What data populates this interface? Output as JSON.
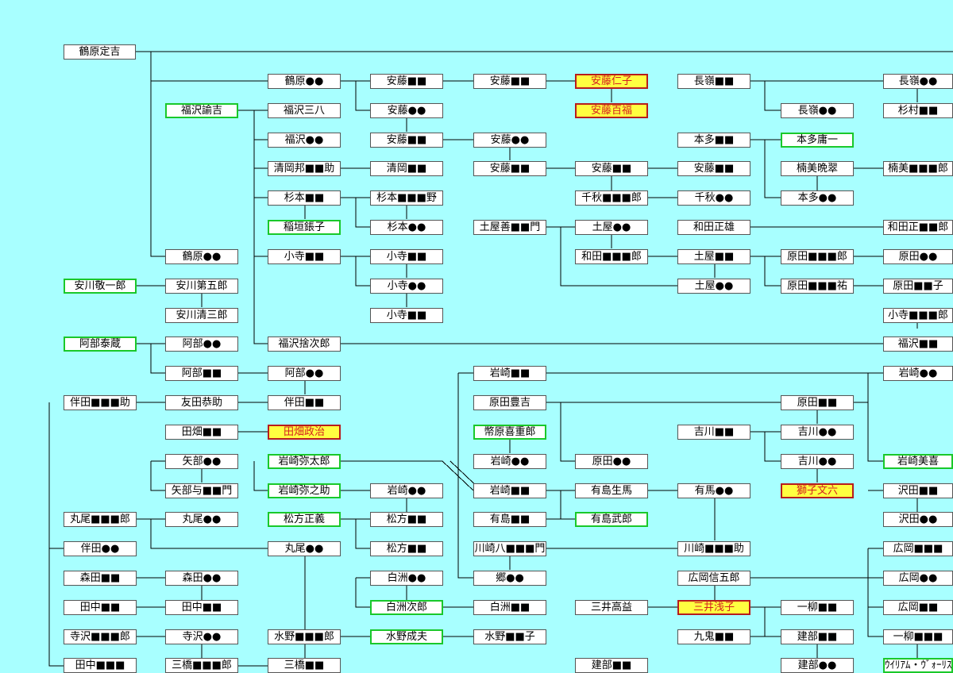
{
  "colors": {
    "background": "#a8ffff",
    "line": "#000000",
    "green_border": "#19c82a",
    "red_border": "#b71c1c",
    "highlight_fill": "#ffff40",
    "highlight_text": "#d42020"
  },
  "nodes": [
    {
      "text": "鶴原定吉",
      "style": "plain"
    },
    {
      "text": "鶴原●●",
      "style": "plain"
    },
    {
      "text": "福沢諭吉",
      "style": "green"
    },
    {
      "text": "福沢三八",
      "style": "plain"
    },
    {
      "text": "福沢●●",
      "style": "plain"
    },
    {
      "text": "清岡邦■■助",
      "style": "plain"
    },
    {
      "text": "杉本■■",
      "style": "plain"
    },
    {
      "text": "稲垣鋹子",
      "style": "green"
    },
    {
      "text": "小寺■■",
      "style": "plain"
    },
    {
      "text": "鶴原●●",
      "style": "plain"
    },
    {
      "text": "安川敬一郎",
      "style": "green"
    },
    {
      "text": "安川第五郎",
      "style": "plain"
    },
    {
      "text": "安川清三郎",
      "style": "plain"
    },
    {
      "text": "阿部泰蔵",
      "style": "green"
    },
    {
      "text": "阿部●●",
      "style": "plain"
    },
    {
      "text": "福沢捨次郎",
      "style": "plain"
    },
    {
      "text": "阿部■■",
      "style": "plain"
    },
    {
      "text": "阿部●●",
      "style": "plain"
    },
    {
      "text": "伴田■■■助",
      "style": "plain"
    },
    {
      "text": "友田恭助",
      "style": "plain"
    },
    {
      "text": "伴田■■",
      "style": "plain"
    },
    {
      "text": "田畑■■",
      "style": "plain"
    },
    {
      "text": "田畑政治",
      "style": "red"
    },
    {
      "text": "矢部●●",
      "style": "plain"
    },
    {
      "text": "岩崎弥太郎",
      "style": "green"
    },
    {
      "text": "矢部与■■門",
      "style": "plain"
    },
    {
      "text": "岩崎弥之助",
      "style": "green"
    },
    {
      "text": "丸尾■■■郎",
      "style": "plain"
    },
    {
      "text": "丸尾●●",
      "style": "plain"
    },
    {
      "text": "松方正義",
      "style": "green"
    },
    {
      "text": "伴田●●",
      "style": "plain"
    },
    {
      "text": "丸尾●●",
      "style": "plain"
    },
    {
      "text": "森田■■",
      "style": "plain"
    },
    {
      "text": "森田●●",
      "style": "plain"
    },
    {
      "text": "田中■■",
      "style": "plain"
    },
    {
      "text": "田中■■",
      "style": "plain"
    },
    {
      "text": "寺沢■■■郎",
      "style": "plain"
    },
    {
      "text": "寺沢●●",
      "style": "plain"
    },
    {
      "text": "水野■■■郎",
      "style": "plain"
    },
    {
      "text": "田中■■■",
      "style": "plain"
    },
    {
      "text": "三橋■■■郎",
      "style": "plain"
    },
    {
      "text": "三橋■■",
      "style": "plain"
    },
    {
      "text": "安藤■■",
      "style": "plain"
    },
    {
      "text": "安藤●●",
      "style": "plain"
    },
    {
      "text": "安藤■■",
      "style": "plain"
    },
    {
      "text": "清岡■■",
      "style": "plain"
    },
    {
      "text": "杉本■■■野",
      "style": "plain"
    },
    {
      "text": "杉本●●",
      "style": "plain"
    },
    {
      "text": "小寺■■",
      "style": "plain"
    },
    {
      "text": "小寺●●",
      "style": "plain"
    },
    {
      "text": "小寺■■",
      "style": "plain"
    },
    {
      "text": "岩崎●●",
      "style": "plain"
    },
    {
      "text": "松方■■",
      "style": "plain"
    },
    {
      "text": "松方■■",
      "style": "plain"
    },
    {
      "text": "白洲●●",
      "style": "plain"
    },
    {
      "text": "白洲次郎",
      "style": "green"
    },
    {
      "text": "水野成夫",
      "style": "green"
    },
    {
      "text": "安藤■■",
      "style": "plain"
    },
    {
      "text": "安藤●●",
      "style": "plain"
    },
    {
      "text": "安藤■■",
      "style": "plain"
    },
    {
      "text": "土屋善■■門",
      "style": "plain"
    },
    {
      "text": "岩崎■■",
      "style": "plain"
    },
    {
      "text": "原田豊吉",
      "style": "plain"
    },
    {
      "text": "幣原喜重郎",
      "style": "green"
    },
    {
      "text": "岩崎●●",
      "style": "plain"
    },
    {
      "text": "岩崎■■",
      "style": "plain"
    },
    {
      "text": "有島■■",
      "style": "plain"
    },
    {
      "text": "川崎八■■■門",
      "style": "plain"
    },
    {
      "text": "郷●●",
      "style": "plain"
    },
    {
      "text": "白洲■■",
      "style": "plain"
    },
    {
      "text": "水野■■子",
      "style": "plain"
    },
    {
      "text": "安藤仁子",
      "style": "red"
    },
    {
      "text": "安藤百福",
      "style": "red"
    },
    {
      "text": "安藤■■",
      "style": "plain"
    },
    {
      "text": "千秋■■■郎",
      "style": "plain"
    },
    {
      "text": "土屋●●",
      "style": "plain"
    },
    {
      "text": "和田■■■郎",
      "style": "plain"
    },
    {
      "text": "原田●●",
      "style": "plain"
    },
    {
      "text": "有島生馬",
      "style": "plain"
    },
    {
      "text": "有島武郎",
      "style": "green"
    },
    {
      "text": "三井高益",
      "style": "plain"
    },
    {
      "text": "建部■■",
      "style": "plain"
    },
    {
      "text": "長嶺■■",
      "style": "plain"
    },
    {
      "text": "本多■■",
      "style": "plain"
    },
    {
      "text": "安藤■■",
      "style": "plain"
    },
    {
      "text": "千秋●●",
      "style": "plain"
    },
    {
      "text": "和田正雄",
      "style": "plain"
    },
    {
      "text": "土屋■■",
      "style": "plain"
    },
    {
      "text": "土屋●●",
      "style": "plain"
    },
    {
      "text": "吉川■■",
      "style": "plain"
    },
    {
      "text": "有馬●●",
      "style": "plain"
    },
    {
      "text": "川崎■■■助",
      "style": "plain"
    },
    {
      "text": "広岡信五郎",
      "style": "plain"
    },
    {
      "text": "三井浅子",
      "style": "red"
    },
    {
      "text": "九鬼■■",
      "style": "plain"
    },
    {
      "text": "長嶺●●",
      "style": "plain"
    },
    {
      "text": "本多庸一",
      "style": "green"
    },
    {
      "text": "楠美晩翠",
      "style": "plain"
    },
    {
      "text": "本多●●",
      "style": "plain"
    },
    {
      "text": "原田■■■郎",
      "style": "plain"
    },
    {
      "text": "原田■■■祐",
      "style": "plain"
    },
    {
      "text": "原田■■",
      "style": "plain"
    },
    {
      "text": "吉川●●",
      "style": "plain"
    },
    {
      "text": "吉川●●",
      "style": "plain"
    },
    {
      "text": "獅子文六",
      "style": "red"
    },
    {
      "text": "一柳■■",
      "style": "plain"
    },
    {
      "text": "建部■■",
      "style": "plain"
    },
    {
      "text": "建部●●",
      "style": "plain"
    },
    {
      "text": "長嶺●●",
      "style": "plain"
    },
    {
      "text": "杉村■■",
      "style": "plain"
    },
    {
      "text": "楠美■■■郎",
      "style": "plain"
    },
    {
      "text": "和田正■■郎",
      "style": "plain"
    },
    {
      "text": "原田●●",
      "style": "plain"
    },
    {
      "text": "原田■■子",
      "style": "plain"
    },
    {
      "text": "小寺■■■郎",
      "style": "plain"
    },
    {
      "text": "福沢■■",
      "style": "plain"
    },
    {
      "text": "岩崎●●",
      "style": "plain"
    },
    {
      "text": "岩崎美喜",
      "style": "green"
    },
    {
      "text": "沢田■■",
      "style": "plain"
    },
    {
      "text": "沢田●●",
      "style": "plain"
    },
    {
      "text": "広岡■■■",
      "style": "plain"
    },
    {
      "text": "広岡●●",
      "style": "plain"
    },
    {
      "text": "広岡■■",
      "style": "plain"
    },
    {
      "text": "一柳■■■",
      "style": "plain"
    },
    {
      "text": "ｳｲﾘｱﾑ・ｳﾞｫｰﾘｽﾞ",
      "style": "green"
    }
  ]
}
